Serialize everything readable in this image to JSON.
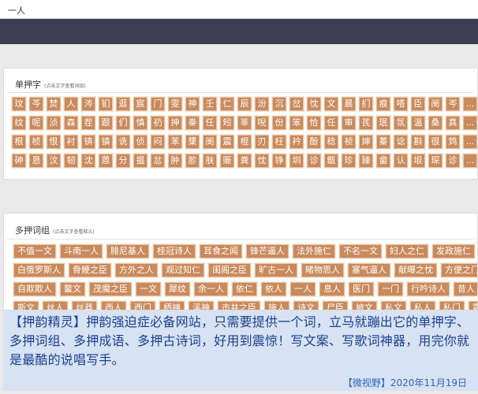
{
  "header": {
    "site_name": "一人"
  },
  "single_rhyme": {
    "title": "单押字",
    "hint": "(点击文字查看词组)",
    "rows": [
      [
        "玟",
        "芩",
        "焚",
        "人",
        "涔",
        "钔",
        "逛",
        "宸",
        "门",
        "雯",
        "神",
        "壬",
        "仁",
        "辰",
        "汾",
        "沉",
        "岔",
        "忱",
        "文",
        "晨",
        "扪",
        "痕",
        "嗒",
        "臣",
        "阌",
        "岑",
        "..."
      ],
      [
        "纹",
        "呢",
        "浈",
        "森",
        "茬",
        "跟",
        "们",
        "慎",
        "礽",
        "抻",
        "桊",
        "任",
        "矧",
        "莘",
        "唲",
        "份",
        "笨",
        "恰",
        "任",
        "审",
        "芪",
        "珉",
        "氛",
        "温",
        "桑",
        "真",
        "..."
      ],
      [
        "根",
        "桢",
        "恨",
        "衬",
        "锛",
        "镇",
        "诜",
        "侦",
        "闷",
        "苯",
        "橥",
        "阌",
        "震",
        "棍",
        "刃",
        "枉",
        "衿",
        "酚",
        "稔",
        "祯",
        "婶",
        "蓁",
        "谂",
        "斟",
        "很",
        "鸩",
        "..."
      ],
      [
        "砷",
        "恳",
        "汶",
        "韧",
        "沈",
        "蒽",
        "分",
        "揾",
        "忿",
        "肿",
        "胗",
        "肤",
        "赈",
        "粪",
        "忱",
        "铮",
        "圳",
        "诊",
        "甑",
        "珍",
        "臻",
        "畲",
        "认",
        "垠",
        "琛",
        "诊",
        "..."
      ]
    ]
  },
  "multi_rhyme": {
    "title": "多押词组",
    "hint": "(点击文字查看释义)",
    "rows": [
      [
        "不值一文",
        "斗南一人",
        "腓尼基人",
        "桂冠诗人",
        "耳食之闻",
        "锋芒逼人",
        "法外施仁",
        "不名一文",
        "妇人之仁",
        "发政施仁",
        "草芥之臣"
      ],
      [
        "白俄罗斯人",
        "骨鲠之臣",
        "方外之人",
        "观过知仁",
        "闺阁之臣",
        "旷古一人",
        "睹物思人",
        "塞气逼人",
        "献曝之忱",
        "方便之门",
        "大开方便"
      ],
      [
        "自欺欺人",
        "鳌文",
        "茂魔之臣",
        "一文",
        "犀纹",
        "余一人",
        "依仁",
        "依人",
        "一人",
        "息人",
        "医门",
        "一门",
        "行吟诗人",
        "昔人",
        "小鸟依人"
      ],
      [
        "斯文",
        "丝人",
        "丝莽",
        "西人",
        "西门",
        "栖神",
        "溪神",
        "市井之臣",
        "施人",
        "诗文",
        "尸臣",
        "披文",
        "私文",
        "私人",
        "私门",
        "霜露之臣",
        "..."
      ]
    ]
  },
  "caption": {
    "text": "【押韵精灵】押韵强迫症必备网站，只需要提供一个词，立马就蹦出它的单押字、多押词组、多押成语、多押古诗词，好用到震惊！写文案、写歌词神器，用完你就是最酷的说唱写手。",
    "source": "【微视野】2020年11月19日"
  }
}
